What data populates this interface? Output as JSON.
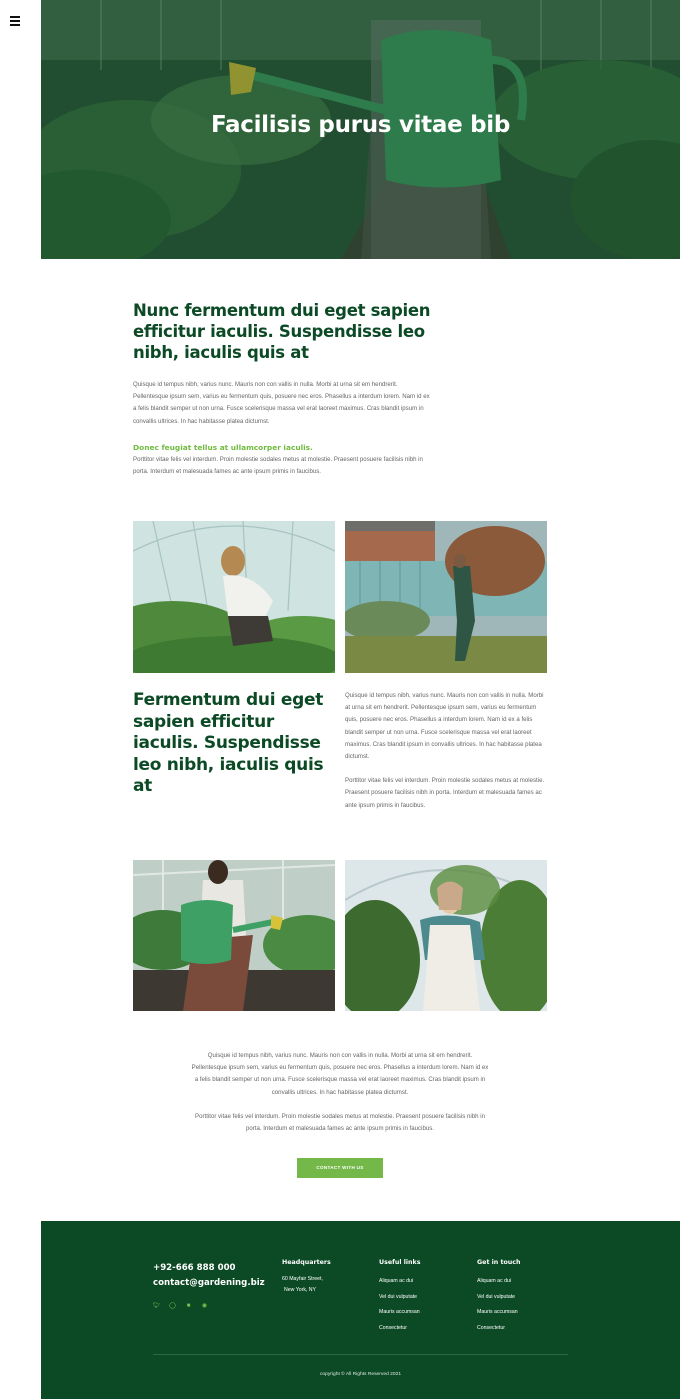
{
  "nav": {
    "menu_icon": "hamburger-menu-icon"
  },
  "hero": {
    "title": "Facilisis purus vitae bib"
  },
  "intro": {
    "heading": "Nunc fermentum dui eget sapien efficitur iaculis.  Suspendisse leo nibh, iaculis quis at",
    "paragraph": "Quisque id tempus nibh, varius nunc. Mauris non con vallis in nulla. Morbi at urna sit em hendrerit. Pellentesque ipsum sem, varius eu fermentum quis, posuere nec eros. Phasellus a interdum lorem. Nam id ex a felis blandit semper ut non urna. Fusce scelerisque massa vel erat laoreet maximus. Cras blandit ipsum in convallis ultrices. In hac habitasse platea dictumst.",
    "subheading": "Donec feugiat tellus at ullamcorper iaculis.",
    "paragraph2": "Porttitor vitae felis vel interdum. Proin molestie sodales metus at molestie. Praesent posuere facilisis nibh in porta. Interdum et malesuada fames ac ante ipsum primis in faucibus."
  },
  "feature": {
    "heading": "Fermentum dui eget sapien efficitur iaculis. Suspendisse leo nibh, iaculis quis at",
    "paragraph": "Quisque id tempus nibh, varius nunc. Mauris non con vallis in nulla. Morbi at urna sit em hendrerit. Pellentesque ipsum sem, varius eu fermentum quis, posuere nec eros. Phasellus a interdum lorem. Nam id ex a felis blandit semper ut non urna. Fusce scelerisque massa vel erat laoreet maximus. Cras blandit ipsum in convallis ultrices. In hac habitasse platea dictumst.",
    "paragraph2": "Porttitor vitae felis vel interdum. Proin molestie sodales metus at molestie. Praesent posuere facilisis nibh in porta. Interdum et malesuada fames ac ante ipsum primis in faucibus."
  },
  "closing": {
    "paragraph": "Quisque id tempus nibh, varius nunc. Mauris non con vallis in nulla. Morbi at urna sit em hendrerit. Pellentesque ipsum sem, varius eu fermentum quis, posuere nec eros. Phasellus a interdum lorem. Nam id ex a felis blandit semper ut non urna. Fusce scelerisque massa vel erat laoreet maximus. Cras blandit ipsum in convallis ultrices. In hac habitasse platea dictumst.",
    "paragraph2": "Porttitor vitae felis vel interdum. Proin molestie sodales metus at molestie. Praesent posuere facilisis nibh in porta. Interdum et malesuada fames ac ante ipsum primis in faucibus.",
    "cta_label": "CONTACT WITH US"
  },
  "footer": {
    "phone": "+92-666 888 000",
    "email": "contact@gardening.biz",
    "socials": [
      "twitter-icon",
      "instagram-icon",
      "facebook-icon",
      "pinterest-icon"
    ],
    "hq_title": "Headquarters",
    "address_line1": "60  Mayfair Street,",
    "address_line2": "New York, NY",
    "useful_title": "Useful links",
    "useful_links": [
      "Aliquam ac dui",
      "Vel dui vulputate",
      "Mauris accumsan",
      "Consectetur"
    ],
    "touch_title": "Get in touch",
    "touch_links": [
      "Aliquam ac dui",
      "Vel dui vulputate",
      "Mauris accumsan",
      "Consectetur"
    ],
    "copyright": "copyright © All Rights Reserved 2021"
  },
  "colors": {
    "brand_green": "#0c4a26",
    "accent_green": "#74b84a",
    "subheading_green": "#6fbb3f"
  }
}
